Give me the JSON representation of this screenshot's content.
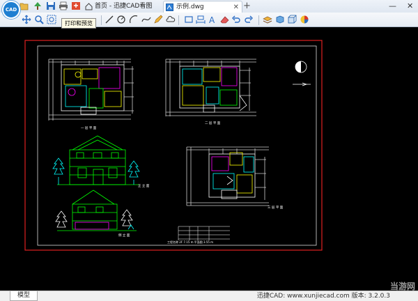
{
  "app": {
    "logo_text": "CAD"
  },
  "tabs": [
    {
      "label": "首页 - 迅捷CAD看图"
    },
    {
      "label": "示例.dwg"
    }
  ],
  "tooltip": "打印和预览",
  "drawing": {
    "captions": [
      "一 层 平 面",
      "二 层 平 面",
      "三 层 平 面",
      "正 立 面",
      "侧 立 面"
    ],
    "footer": "工程名称   2F 7.15 m  平面图   3.55 m"
  },
  "statusbar": {
    "mode": "模型",
    "info": "迅捷CAD: www.xunjiecad.com 版本: 3.2.0.3"
  },
  "watermark": "当游网",
  "colors": {
    "border_red": "#e02020",
    "cyan": "#00ffff",
    "green": "#00ff00",
    "magenta": "#ff00ff",
    "yellow": "#ffff00",
    "white": "#ffffff"
  }
}
